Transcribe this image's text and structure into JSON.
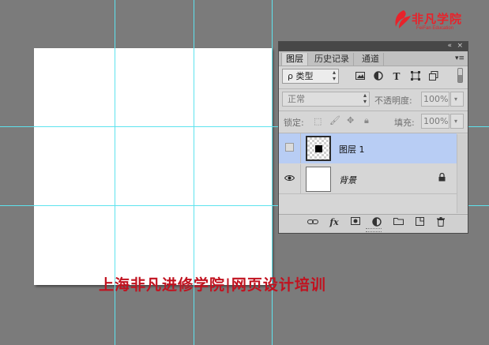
{
  "brand": {
    "title": "非凡学院",
    "subtitle": "FeiFan Education",
    "color": "#e8222a"
  },
  "panel": {
    "header_icons": {
      "collapse": "«",
      "close": "×"
    },
    "tabs": [
      {
        "label": "图层",
        "active": true
      },
      {
        "label": "历史记录",
        "active": false
      },
      {
        "label": "通道",
        "active": false
      }
    ],
    "filter": {
      "kind_label": "类型",
      "search_icon": "ρ",
      "icons": [
        "image-filter-icon",
        "adjustment-filter-icon",
        "type-filter-icon",
        "shape-filter-icon",
        "smart-object-filter-icon"
      ]
    },
    "blend": {
      "mode": "正常",
      "opacity_label": "不透明度:",
      "opacity_value": "100%"
    },
    "lock": {
      "label": "锁定:",
      "fill_label": "填充:",
      "fill_value": "100%"
    },
    "layers": [
      {
        "name": "图层 1",
        "selected": true,
        "visible": false
      },
      {
        "name": "背景",
        "selected": false,
        "visible": true,
        "locked": true
      }
    ],
    "bottom_icons": [
      "link-layers-icon",
      "fx-icon",
      "add-mask-icon",
      "adjustment-layer-icon",
      "new-group-icon",
      "new-layer-icon",
      "trash-icon"
    ],
    "fx_label": "fx"
  },
  "watermark": "上海非凡进修学院|网页设计培训",
  "colors": {
    "workspace": "#7b7b7b",
    "guide": "#5ee3ee",
    "selected_layer": "#b8cdf4",
    "watermark": "#c1121f"
  }
}
